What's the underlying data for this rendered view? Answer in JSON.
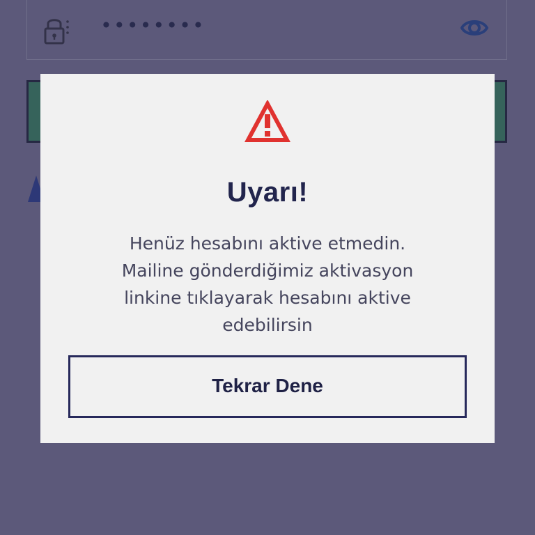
{
  "background": {
    "password_mask": "••••••••",
    "lock_icon": "lock-icon",
    "eye_icon": "eye-icon"
  },
  "dialog": {
    "icon": "warning-icon",
    "title": "Uyarı!",
    "message": "Henüz hesabını aktive etmedin.\nMailine gönderdiğimiz aktivasyon\nlinkine tıklayarak hesabını aktive\nedebilirsin",
    "button_label": "Tekrar Dene"
  },
  "colors": {
    "background": "#5d5a7a",
    "dialog_bg": "#f1f1f1",
    "text_primary": "#22254d",
    "text_secondary": "#45455d",
    "warning": "#e0322f",
    "button_border": "#27295b",
    "green_button": "#2f6655",
    "accent_blue": "#243177"
  }
}
